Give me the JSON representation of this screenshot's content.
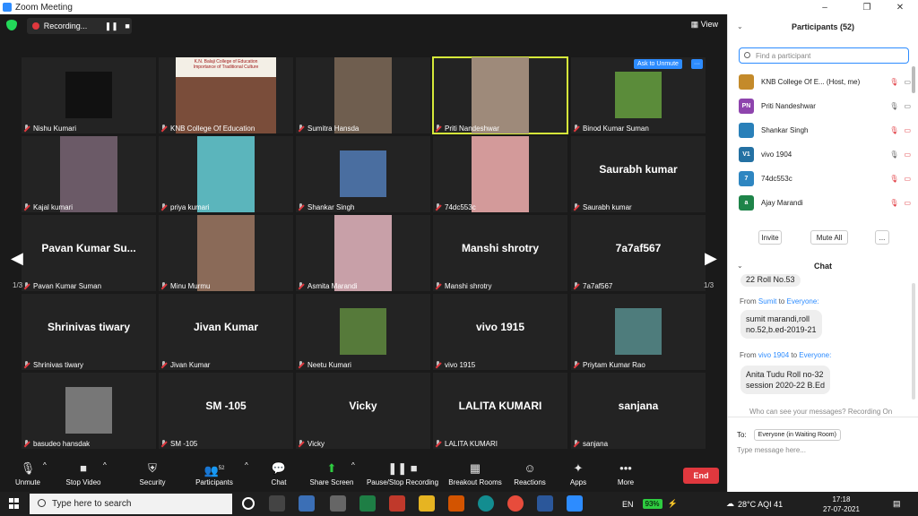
{
  "window": {
    "title": "Zoom Meeting",
    "minimize": "–",
    "maximize": "❐",
    "close": "✕"
  },
  "meeting": {
    "recording_label": "Recording...",
    "pause_glyph": "❚❚",
    "stop_glyph": "■",
    "view_label": "View",
    "view_glyph": "▦",
    "ask_unmute": "Ask to Unmute",
    "more_glyph": "···",
    "page_left": "1/3",
    "page_right": "1/3",
    "arrow_left": "◀",
    "arrow_right": "▶"
  },
  "tiles": [
    {
      "name": "Nishu Kumari",
      "big": ""
    },
    {
      "name": "KNB College Of Education",
      "big": ""
    },
    {
      "name": "Sumitra Hansda",
      "big": ""
    },
    {
      "name": "Priti Nandeshwar",
      "big": ""
    },
    {
      "name": "Binod Kumar Suman",
      "big": ""
    },
    {
      "name": "Kajal kumari",
      "big": ""
    },
    {
      "name": "priya kumari",
      "big": ""
    },
    {
      "name": "Shankar Singh",
      "big": ""
    },
    {
      "name": "74dc553c",
      "big": ""
    },
    {
      "name": "Saurabh kumar",
      "big": "Saurabh kumar"
    },
    {
      "name": "Pavan Kumar Suman",
      "big": "Pavan Kumar Su..."
    },
    {
      "name": "Minu Murmu",
      "big": ""
    },
    {
      "name": "Asmita Marandi",
      "big": ""
    },
    {
      "name": "Manshi shrotry",
      "big": "Manshi shrotry"
    },
    {
      "name": "7a7af567",
      "big": "7a7af567"
    },
    {
      "name": "Shrinivas tiwary",
      "big": "Shrinivas tiwary"
    },
    {
      "name": "Jivan Kumar",
      "big": "Jivan Kumar"
    },
    {
      "name": "Neetu Kumari",
      "big": ""
    },
    {
      "name": "vivo 1915",
      "big": "vivo 1915"
    },
    {
      "name": "Priytam Kumar Rao",
      "big": ""
    },
    {
      "name": "basudeo hansdak",
      "big": ""
    },
    {
      "name": "SM -105",
      "big": "SM -105"
    },
    {
      "name": "Vicky",
      "big": "Vicky"
    },
    {
      "name": "LALITA KUMARI",
      "big": "LALITA KUMARI"
    },
    {
      "name": "sanjana",
      "big": "sanjana"
    }
  ],
  "tile_photo_text": {
    "college_line1": "K.N. Balaji College of Education",
    "college_line2": "Importance of Traditional Culture"
  },
  "toolbar": {
    "unmute": "Unmute",
    "stop_video": "Stop Video",
    "security": "Security",
    "participants": "Participants",
    "participants_count": "52",
    "chat": "Chat",
    "share_screen": "Share Screen",
    "pause_stop_recording": "Pause/Stop Recording",
    "breakout_rooms": "Breakout Rooms",
    "reactions": "Reactions",
    "apps": "Apps",
    "more": "More",
    "end": "End",
    "caret": "^"
  },
  "participants_panel": {
    "title": "Participants (52)",
    "collapse_glyph": "⌄",
    "search_placeholder": "Find a participant",
    "rows": [
      {
        "avatar": "",
        "name": "KNB College Of E... (Host, me)",
        "color": "#c48a2a"
      },
      {
        "avatar": "PN",
        "name": "Priti Nandeshwar",
        "color": "#8e44ad"
      },
      {
        "avatar": "",
        "name": "Shankar Singh",
        "color": "#2980b9"
      },
      {
        "avatar": "V1",
        "name": "vivo 1904",
        "color": "#2471a3"
      },
      {
        "avatar": "7",
        "name": "74dc553c",
        "color": "#2e86c1"
      },
      {
        "avatar": "a",
        "name": "Ajay Marandi",
        "color": "#1e8449"
      }
    ],
    "invite": "Invite",
    "mute_all": "Mute All",
    "more": "..."
  },
  "chat": {
    "title": "Chat",
    "collapse_glyph": "⌄",
    "partial_msg": "22 Roll No.53",
    "from1_prefix": "From",
    "from1_sender": "Sumit",
    "from1_to": "to",
    "from1_target": "Everyone:",
    "msg1_line1": "sumit marandi,roll",
    "msg1_line2": "no.52,b.ed-2019-21",
    "from2_prefix": "From",
    "from2_sender": "vivo 1904",
    "from2_to": "to",
    "from2_target": "Everyone:",
    "msg2_line1": "Anita Tudu Roll no-32",
    "msg2_line2": "session 2020-22 B.Ed",
    "who_can_see": "Who can see your messages? Recording On",
    "to_label": "To:",
    "to_value": "Everyone (in Waiting Room)",
    "placeholder": "Type message here..."
  },
  "taskbar": {
    "search_placeholder": "Type here to search",
    "lang": "EN",
    "battery": "93%",
    "weather": "28°C AQI 41",
    "time": "17:18",
    "date": "27-07-2021"
  },
  "colors": {
    "accent": "#2d8cff",
    "end_red": "#e0383e",
    "active_border": "#d6e93a",
    "share_green": "#2ecc40"
  }
}
